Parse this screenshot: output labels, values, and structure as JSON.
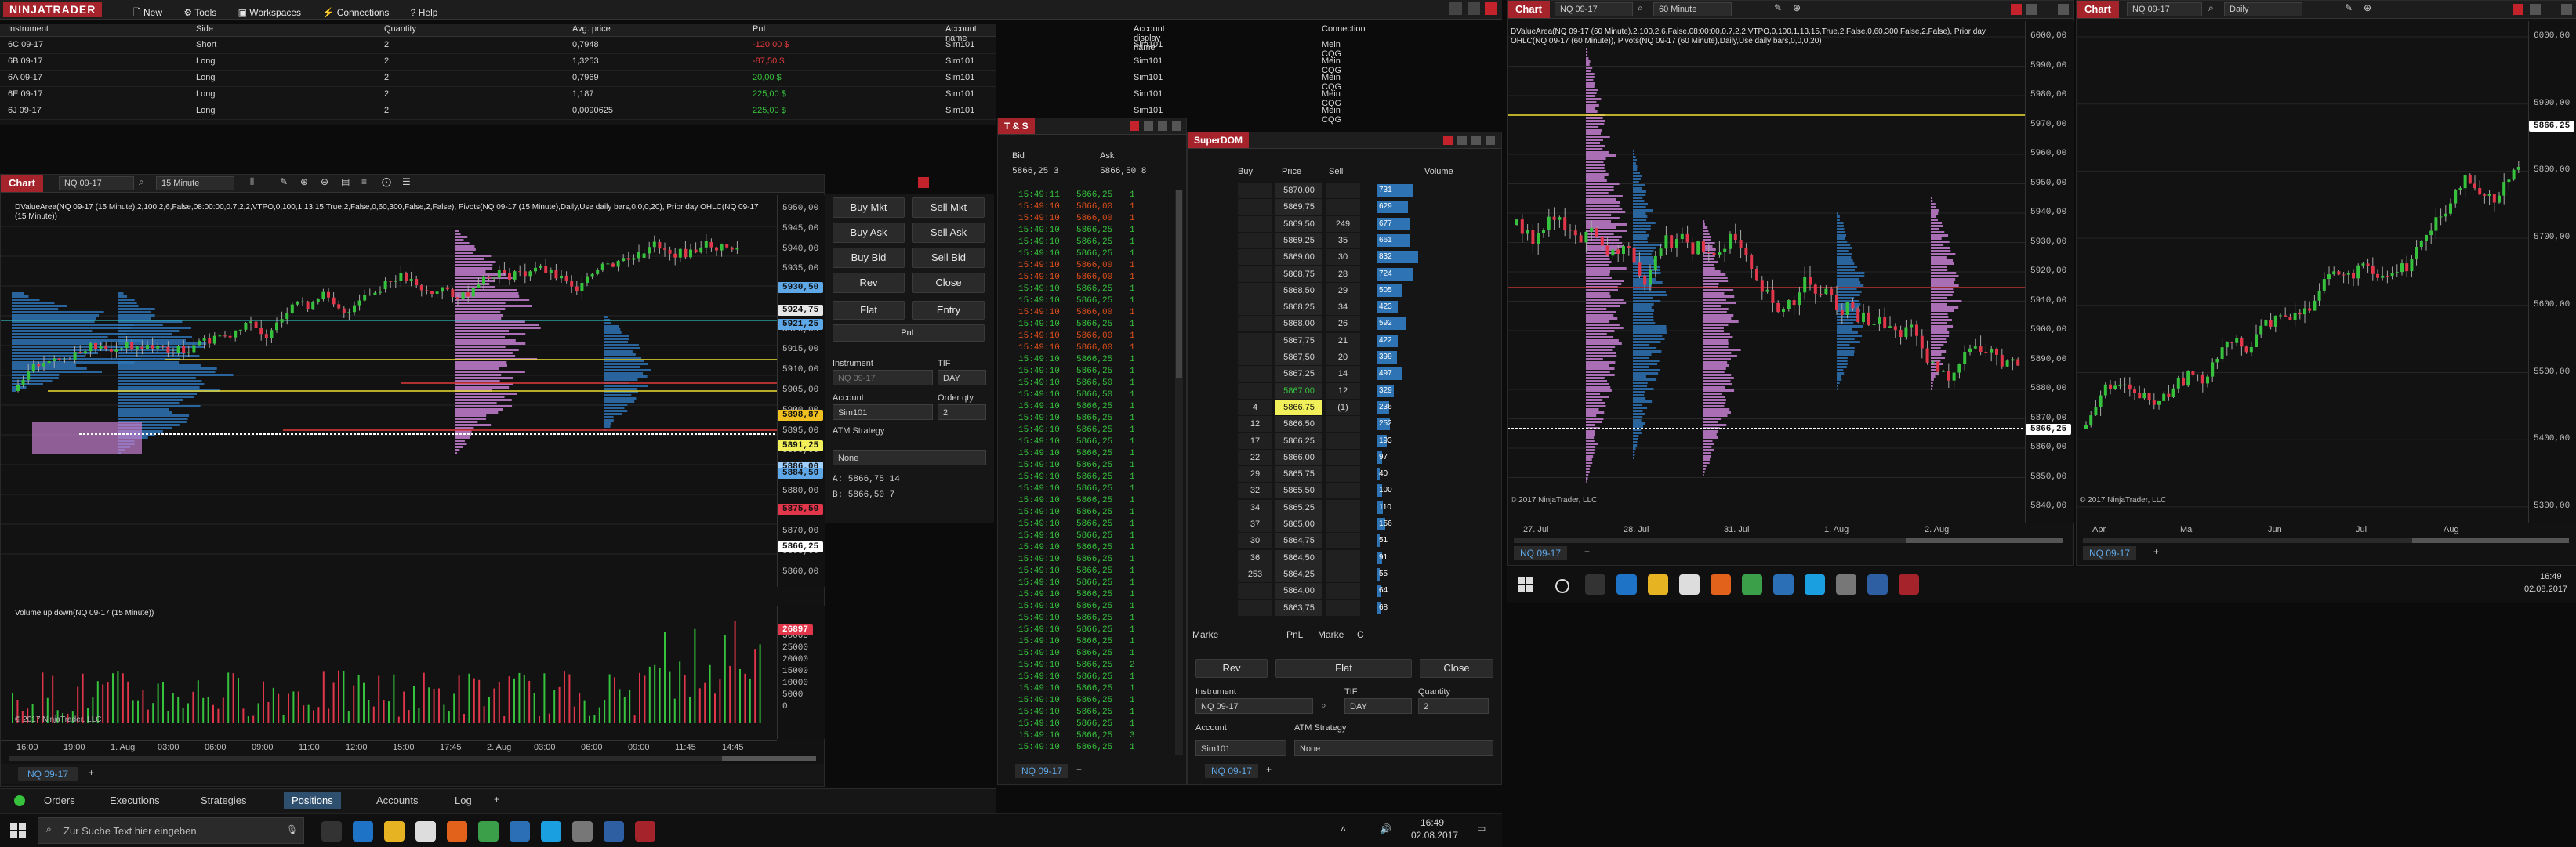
{
  "app": {
    "logo": "NINJATRADER",
    "menu": [
      {
        "label": "New",
        "icon": "document-icon"
      },
      {
        "label": "Tools",
        "icon": "gear-icon"
      },
      {
        "label": "Workspaces",
        "icon": "folder-icon"
      },
      {
        "label": "Connections",
        "icon": "plug-icon"
      },
      {
        "label": "Help",
        "icon": "question-icon"
      }
    ]
  },
  "positions": {
    "headers": [
      "Instrument",
      "Side",
      "Quantity",
      "Avg. price",
      "PnL",
      "Account name",
      "Account display name",
      "Connection"
    ],
    "rows": [
      {
        "instrument": "6C 09-17",
        "side": "Short",
        "qty": "2",
        "avg": "0,7948",
        "pnl": "-120,00 $",
        "pnl_color": "#e23b3b",
        "account": "Sim101",
        "display": "Sim101",
        "conn": "Mein CQG"
      },
      {
        "instrument": "6B 09-17",
        "side": "Long",
        "qty": "2",
        "avg": "1,3253",
        "pnl": "-87,50 $",
        "pnl_color": "#e23b3b",
        "account": "Sim101",
        "display": "Sim101",
        "conn": "Mein CQG"
      },
      {
        "instrument": "6A 09-17",
        "side": "Long",
        "qty": "2",
        "avg": "0,7969",
        "pnl": "20,00 $",
        "pnl_color": "#36c23d",
        "account": "Sim101",
        "display": "Sim101",
        "conn": "Mein CQG"
      },
      {
        "instrument": "6E 09-17",
        "side": "Long",
        "qty": "2",
        "avg": "1,187",
        "pnl": "225,00 $",
        "pnl_color": "#36c23d",
        "account": "Sim101",
        "display": "Sim101",
        "conn": "Mein CQG"
      },
      {
        "instrument": "6J 09-17",
        "side": "Long",
        "qty": "2",
        "avg": "0,0090625",
        "pnl": "225,00 $",
        "pnl_color": "#36c23d",
        "account": "Sim101",
        "display": "Sim101",
        "conn": "Mein CQG"
      }
    ]
  },
  "chart1": {
    "title": "Chart",
    "instrument": "NQ 09-17",
    "interval": "15 Minute",
    "indicator_text": "DValueArea(NQ 09-17 (15 Minute),2,100,2,6,False,08:00:00,0.7,2,2,VTPO,0,100,1,13,15,True,2,False,0,60,300,False,2,False), Pivots(NQ 09-17 (15 Minute),Daily,Use daily bars,0,0,0,20), Prior day OHLC(NQ 09-17 (15 Minute))",
    "volume_title": "Volume up down(NQ 09-17 (15 Minute))",
    "copyright": "© 2017 NinjaTrader, LLC",
    "price_ticks": [
      "5950,00",
      "5945,00",
      "5940,00",
      "5935,00",
      "5930,00",
      "5925,00",
      "5920,00",
      "5915,00",
      "5910,00",
      "5905,00",
      "5900,00",
      "5895,00",
      "5890,00",
      "5885,00",
      "5880,00",
      "5875,00",
      "5870,00",
      "5865,00",
      "5860,00"
    ],
    "price_tags": [
      {
        "text": "5930,50",
        "color": "#5fa8e8"
      },
      {
        "text": "5924,75",
        "color": "#e6e6e6"
      },
      {
        "text": "5921,25",
        "color": "#5fa8e8"
      },
      {
        "text": "5898,87",
        "color": "#f0c020"
      },
      {
        "text": "5891,25",
        "color": "#f2f05a"
      },
      {
        "text": "5886,00",
        "color": "#9fd0ff"
      },
      {
        "text": "5884,50",
        "color": "#5fa8e8"
      },
      {
        "text": "5875,50",
        "color": "#e2364a"
      },
      {
        "text": "5866,25",
        "color": "#ffffff"
      }
    ],
    "vol_ticks": [
      "30000",
      "25000",
      "20000",
      "15000",
      "10000",
      "5000",
      "0"
    ],
    "vol_tag": "26897",
    "time_ticks": [
      "16:00",
      "19:00",
      "1. Aug",
      "03:00",
      "06:00",
      "09:00",
      "11:00",
      "12:00",
      "15:00",
      "17:45",
      "2. Aug",
      "03:00",
      "06:00",
      "09:00",
      "11:45",
      "14:45"
    ],
    "tab": "NQ 09-17"
  },
  "chart_trader": {
    "buttons": [
      "Buy Mkt",
      "Sell Mkt",
      "Buy Ask",
      "Sell Ask",
      "Buy Bid",
      "Sell Bid",
      "Rev",
      "Close",
      "Flat",
      "Entry",
      "PnL"
    ],
    "instrument_label": "Instrument",
    "instrument_value": "NQ 09-17",
    "tif_label": "TIF",
    "tif_value": "DAY",
    "account_label": "Account",
    "account_value": "Sim101",
    "qty_label": "Order qty",
    "qty_value": "2",
    "atm_label": "ATM Strategy",
    "atm_value": "None",
    "ask_line": "A:  5866,75        14",
    "bid_line": "B:  5866,50        7"
  },
  "bottom_tabs": {
    "tabs": [
      "Orders",
      "Executions",
      "Strategies",
      "Positions",
      "Accounts",
      "Log"
    ],
    "active": "Positions"
  },
  "ts": {
    "title": "T & S",
    "header_bid": "Bid",
    "header_ask": "Ask",
    "bid_line": "5866,25   3",
    "ask_line": "5866,50   8",
    "tab": "NQ 09-17",
    "rows": [
      [
        "15:49:11",
        "5866,25",
        "1",
        "#36c23d"
      ],
      [
        "15:49:10",
        "5866,00",
        "1",
        "#e2501c"
      ],
      [
        "15:49:10",
        "5866,00",
        "1",
        "#e2501c"
      ],
      [
        "15:49:10",
        "5866,25",
        "1",
        "#36c23d"
      ],
      [
        "15:49:10",
        "5866,25",
        "1",
        "#36c23d"
      ],
      [
        "15:49:10",
        "5866,25",
        "1",
        "#36c23d"
      ],
      [
        "15:49:10",
        "5866,00",
        "1",
        "#e2501c"
      ],
      [
        "15:49:10",
        "5866,00",
        "1",
        "#e2501c"
      ],
      [
        "15:49:10",
        "5866,25",
        "1",
        "#36c23d"
      ],
      [
        "15:49:10",
        "5866,25",
        "1",
        "#36c23d"
      ],
      [
        "15:49:10",
        "5866,00",
        "1",
        "#e2501c"
      ],
      [
        "15:49:10",
        "5866,25",
        "1",
        "#36c23d"
      ],
      [
        "15:49:10",
        "5866,00",
        "1",
        "#e2501c"
      ],
      [
        "15:49:10",
        "5866,00",
        "1",
        "#e2501c"
      ],
      [
        "15:49:10",
        "5866,25",
        "1",
        "#36c23d"
      ],
      [
        "15:49:10",
        "5866,25",
        "1",
        "#36c23d"
      ],
      [
        "15:49:10",
        "5866,50",
        "1",
        "#36c23d"
      ],
      [
        "15:49:10",
        "5866,50",
        "1",
        "#36c23d"
      ],
      [
        "15:49:10",
        "5866,25",
        "1",
        "#36c23d"
      ],
      [
        "15:49:10",
        "5866,25",
        "1",
        "#36c23d"
      ],
      [
        "15:49:10",
        "5866,25",
        "1",
        "#36c23d"
      ],
      [
        "15:49:10",
        "5866,25",
        "1",
        "#36c23d"
      ],
      [
        "15:49:10",
        "5866,25",
        "1",
        "#36c23d"
      ],
      [
        "15:49:10",
        "5866,25",
        "1",
        "#36c23d"
      ],
      [
        "15:49:10",
        "5866,25",
        "1",
        "#36c23d"
      ],
      [
        "15:49:10",
        "5866,25",
        "1",
        "#36c23d"
      ],
      [
        "15:49:10",
        "5866,25",
        "1",
        "#36c23d"
      ],
      [
        "15:49:10",
        "5866,25",
        "1",
        "#36c23d"
      ],
      [
        "15:49:10",
        "5866,25",
        "1",
        "#36c23d"
      ],
      [
        "15:49:10",
        "5866,25",
        "1",
        "#36c23d"
      ],
      [
        "15:49:10",
        "5866,25",
        "1",
        "#36c23d"
      ],
      [
        "15:49:10",
        "5866,25",
        "1",
        "#36c23d"
      ],
      [
        "15:49:10",
        "5866,25",
        "1",
        "#36c23d"
      ],
      [
        "15:49:10",
        "5866,25",
        "1",
        "#36c23d"
      ],
      [
        "15:49:10",
        "5866,25",
        "1",
        "#36c23d"
      ],
      [
        "15:49:10",
        "5866,25",
        "1",
        "#36c23d"
      ],
      [
        "15:49:10",
        "5866,25",
        "1",
        "#36c23d"
      ],
      [
        "15:49:10",
        "5866,25",
        "1",
        "#36c23d"
      ],
      [
        "15:49:10",
        "5866,25",
        "1",
        "#36c23d"
      ],
      [
        "15:49:10",
        "5866,25",
        "1",
        "#36c23d"
      ],
      [
        "15:49:10",
        "5866,25",
        "2",
        "#36c23d"
      ],
      [
        "15:49:10",
        "5866,25",
        "1",
        "#36c23d"
      ],
      [
        "15:49:10",
        "5866,25",
        "1",
        "#36c23d"
      ],
      [
        "15:49:10",
        "5866,25",
        "1",
        "#36c23d"
      ],
      [
        "15:49:10",
        "5866,25",
        "1",
        "#36c23d"
      ],
      [
        "15:49:10",
        "5866,25",
        "1",
        "#36c23d"
      ],
      [
        "15:49:10",
        "5866,25",
        "3",
        "#36c23d"
      ],
      [
        "15:49:10",
        "5866,25",
        "1",
        "#36c23d"
      ]
    ]
  },
  "superdom": {
    "title": "SuperDOM",
    "headers": [
      "Buy",
      "Price",
      "Sell",
      "Volume"
    ],
    "rows": [
      {
        "buy": "",
        "price": "5870,00",
        "sell": "",
        "vol": "731"
      },
      {
        "buy": "",
        "price": "5869,75",
        "sell": "",
        "vol": "629"
      },
      {
        "buy": "",
        "price": "5869,50",
        "sell": "249",
        "vol": "677"
      },
      {
        "buy": "",
        "price": "5869,25",
        "sell": "35",
        "vol": "661"
      },
      {
        "buy": "",
        "price": "5869,00",
        "sell": "30",
        "vol": "832"
      },
      {
        "buy": "",
        "price": "5868,75",
        "sell": "28",
        "vol": "724"
      },
      {
        "buy": "",
        "price": "5868,50",
        "sell": "29",
        "vol": "505"
      },
      {
        "buy": "",
        "price": "5868,25",
        "sell": "34",
        "vol": "423"
      },
      {
        "buy": "",
        "price": "5868,00",
        "sell": "26",
        "vol": "592"
      },
      {
        "buy": "",
        "price": "5867,75",
        "sell": "21",
        "vol": "422"
      },
      {
        "buy": "",
        "price": "5867,50",
        "sell": "20",
        "vol": "399"
      },
      {
        "buy": "",
        "price": "5867,25",
        "sell": "14",
        "vol": "497"
      },
      {
        "buy": "",
        "price": "5867,00",
        "sell": "12",
        "vol": "329"
      },
      {
        "buy": "4",
        "price": "5866,75",
        "sell": "(1)",
        "vol": "236"
      },
      {
        "buy": "12",
        "price": "5866,50",
        "sell": "",
        "vol": "252"
      },
      {
        "buy": "17",
        "price": "5866,25",
        "sell": "",
        "vol": "193"
      },
      {
        "buy": "22",
        "price": "5866,00",
        "sell": "",
        "vol": "97"
      },
      {
        "buy": "29",
        "price": "5865,75",
        "sell": "",
        "vol": "40"
      },
      {
        "buy": "32",
        "price": "5865,50",
        "sell": "",
        "vol": "100"
      },
      {
        "buy": "34",
        "price": "5865,25",
        "sell": "",
        "vol": "110"
      },
      {
        "buy": "37",
        "price": "5865,00",
        "sell": "",
        "vol": "156"
      },
      {
        "buy": "30",
        "price": "5864,75",
        "sell": "",
        "vol": "51"
      },
      {
        "buy": "36",
        "price": "5864,50",
        "sell": "",
        "vol": "91"
      },
      {
        "buy": "253",
        "price": "5864,25",
        "sell": "",
        "vol": "55"
      },
      {
        "buy": "",
        "price": "5864,00",
        "sell": "",
        "vol": "64"
      },
      {
        "buy": "",
        "price": "5863,75",
        "sell": "",
        "vol": "68"
      }
    ],
    "footer_left": "Marke",
    "footer_mid": "PnL",
    "footer_right": "Marke",
    "footer_c": "C",
    "rev": "Rev",
    "flat": "Flat",
    "close": "Close",
    "instrument_label": "Instrument",
    "instrument_value": "NQ 09-17",
    "tif_label": "TIF",
    "tif_value": "DAY",
    "qty_label": "Quantity",
    "qty_value": "2",
    "account_label": "Account",
    "account_value": "Sim101",
    "atm_label": "ATM Strategy",
    "atm_value": "None",
    "tab": "NQ 09-17"
  },
  "chart2": {
    "title": "Chart",
    "instrument": "NQ 09-17",
    "interval": "60 Minute",
    "indicator_text": "DValueArea(NQ 09-17 (60 Minute),2,100,2,6,False,08:00:00,0.7,2,2,VTPO,0,100,1,13,15,True,2,False,0,60,300,False,2,False), Prior day OHLC(NQ 09-17 (60 Minute)), Pivots(NQ 09-17 (60 Minute),Daily,Use daily bars,0,0,0,20)",
    "price_ticks": [
      "6000,00",
      "5990,00",
      "5980,00",
      "5970,00",
      "5960,00",
      "5950,00",
      "5940,00",
      "5930,00",
      "5920,00",
      "5910,00",
      "5900,00",
      "5890,00",
      "5880,00",
      "5870,00",
      "5860,00",
      "5850,00",
      "5840,00"
    ],
    "last_tag": "5866,25",
    "time_ticks": [
      "27. Jul",
      "28. Jul",
      "31. Jul",
      "1. Aug",
      "2. Aug"
    ],
    "copyright": "© 2017 NinjaTrader, LLC",
    "tab": "NQ 09-17"
  },
  "chart3": {
    "title": "Chart",
    "instrument": "NQ 09-17",
    "interval": "Daily",
    "price_ticks": [
      "6000,00",
      "5900,00",
      "5800,00",
      "5700,00",
      "5600,00",
      "5500,00",
      "5400,00",
      "5300,00"
    ],
    "last_tag": "5866,25",
    "time_ticks": [
      "Apr",
      "Mai",
      "Jun",
      "Jul",
      "Aug"
    ],
    "copyright": "© 2017 NinjaTrader, LLC",
    "tab": "NQ 09-17"
  },
  "taskbar": {
    "search_placeholder": "Zur Suche Text hier eingeben",
    "time": "16:49",
    "date": "02.08.2017",
    "time2": "16:49",
    "date2": "02.08.2017"
  },
  "colors": {
    "accent": "#a5232b",
    "up": "#36c23d",
    "down": "#e2364a",
    "profile_blue": "#2e74b5",
    "profile_pink": "#c47fd0"
  }
}
